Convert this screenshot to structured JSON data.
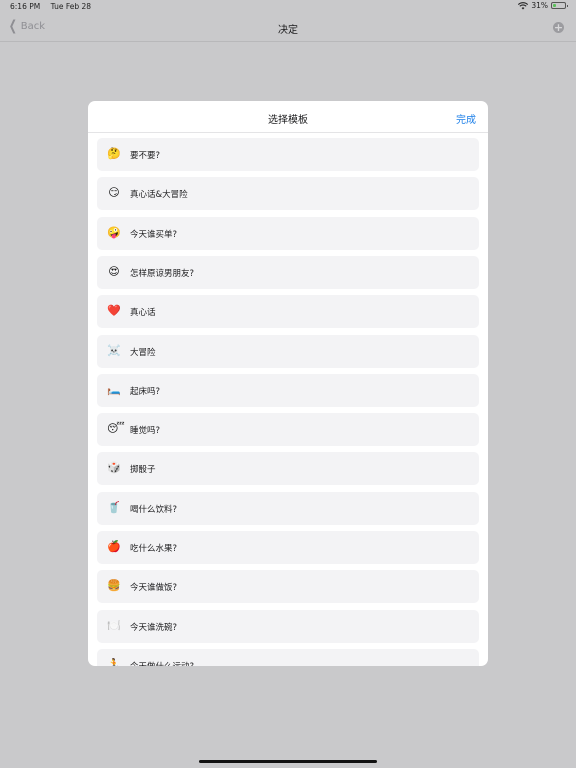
{
  "status_bar": {
    "time": "6:16 PM",
    "date": "Tue Feb 28",
    "battery": "31%",
    "battery_level": 0.31
  },
  "nav_bar": {
    "back_label": "Back",
    "title": "决定",
    "add_icon": "plus-circle-icon"
  },
  "modal": {
    "title": "选择模板",
    "done_label": "完成",
    "items": [
      {
        "icon": "thinking-face-icon",
        "emoji": "🤔",
        "label": "要不要?"
      },
      {
        "icon": "smirking-face-icon",
        "emoji": "😏",
        "label": "真心话&大冒险"
      },
      {
        "icon": "zany-face-icon",
        "emoji": "🤪",
        "label": "今天谁买单?"
      },
      {
        "icon": "heart-eyes-face-icon",
        "emoji": "😍",
        "label": "怎样原谅男朋友?"
      },
      {
        "icon": "red-heart-icon",
        "emoji": "❤️",
        "label": "真心话"
      },
      {
        "icon": "skull-crossbones-icon",
        "emoji": "☠️",
        "label": "大冒险"
      },
      {
        "icon": "bed-icon",
        "emoji": "🛏️",
        "label": "起床吗?"
      },
      {
        "icon": "sleeping-face-icon",
        "emoji": "😴",
        "label": "睡觉吗?"
      },
      {
        "icon": "dice-icon",
        "emoji": "🎲",
        "label": "掷骰子"
      },
      {
        "icon": "drink-icon",
        "emoji": "🥤",
        "label": "喝什么饮料?"
      },
      {
        "icon": "apple-icon",
        "emoji": "🍎",
        "label": "吃什么水果?"
      },
      {
        "icon": "burger-icon",
        "emoji": "🍔",
        "label": "今天谁做饭?"
      },
      {
        "icon": "plate-cutlery-icon",
        "emoji": "🍽️",
        "label": "今天谁洗碗?"
      },
      {
        "icon": "runner-icon",
        "emoji": "🏃",
        "label": "今天做什么运动?"
      }
    ]
  }
}
